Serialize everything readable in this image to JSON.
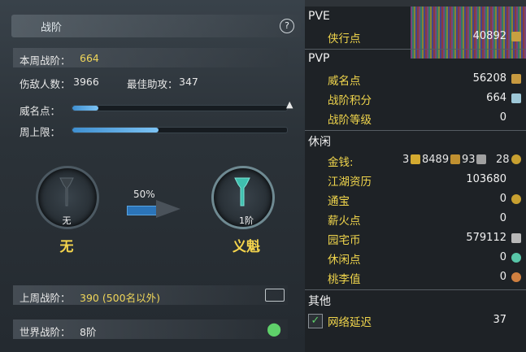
{
  "left": {
    "header": {
      "title": "战阶",
      "help": "?"
    },
    "weekly": {
      "label": "本周战阶：",
      "value": "664"
    },
    "kills": {
      "label": "伤敌人数：",
      "value": "3966"
    },
    "assists": {
      "label": "最佳助攻：",
      "value": "347"
    },
    "fame": {
      "label": "威名点：",
      "progress": 0.12
    },
    "week_cap": {
      "label": "周上限：",
      "progress": 0.4
    },
    "current_rank": {
      "small": "无",
      "big": "无"
    },
    "progress_pct": "50%",
    "next_rank": {
      "small": "1阶",
      "big": "义魁"
    },
    "last_week": {
      "label": "上周战阶：",
      "value": "390 (500名以外)"
    },
    "world": {
      "label": "世界战阶：",
      "value": "8阶"
    }
  },
  "right": {
    "pve": {
      "title": "PVE",
      "items": [
        {
          "label": "侠行点",
          "value": "40892"
        }
      ]
    },
    "pvp": {
      "title": "PVP",
      "items": [
        {
          "label": "威名点",
          "value": "56208"
        },
        {
          "label": "战阶积分",
          "value": "664"
        },
        {
          "label": "战阶等级",
          "value": "0"
        }
      ]
    },
    "leisure": {
      "title": "休闲",
      "items": [
        {
          "label": "金钱:",
          "value": "3",
          "v2": "8489",
          "v3": "93",
          "v4": "28"
        },
        {
          "label": "江湖资历",
          "value": "103680"
        },
        {
          "label": "通宝",
          "value": "0"
        },
        {
          "label": "薪火点",
          "value": "0"
        },
        {
          "label": "园宅币",
          "value": "579112"
        },
        {
          "label": "休闲点",
          "value": "0"
        },
        {
          "label": "桃李值",
          "value": "0"
        }
      ]
    },
    "other": {
      "title": "其他",
      "items": [
        {
          "label": "网络延迟",
          "value": "37",
          "checked": true
        }
      ]
    },
    "colors": {
      "accent": "#f0d54c",
      "bar": "#4a9ee0"
    }
  }
}
